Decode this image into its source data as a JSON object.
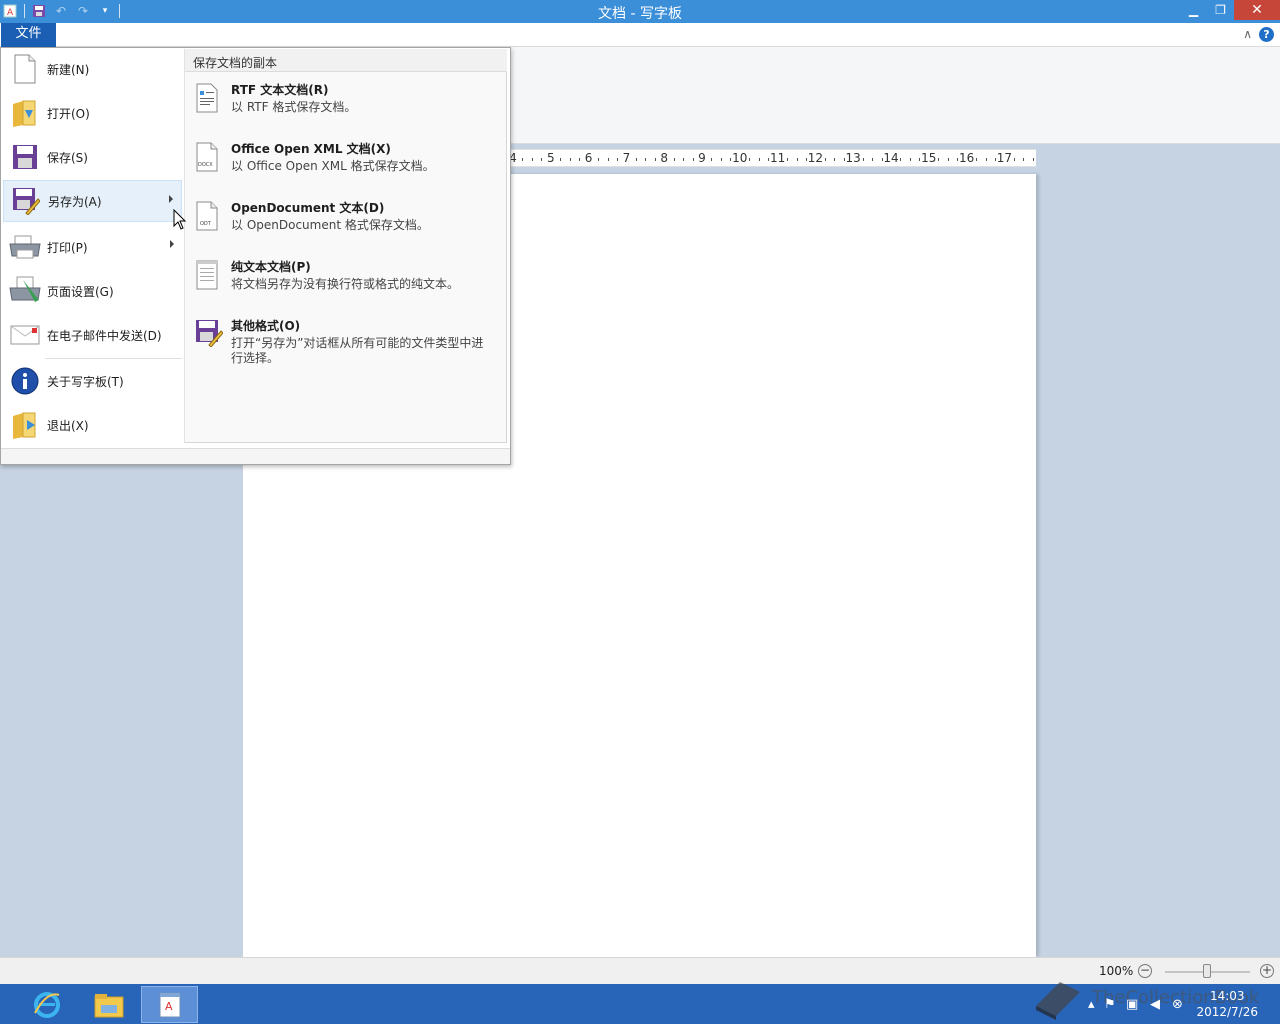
{
  "window": {
    "title": "文档 - 写字板"
  },
  "ribbon": {
    "file_tab": "文件",
    "help": "?",
    "collapse": "∧"
  },
  "ruler": {
    "labels": [
      "4",
      "5",
      "6",
      "7",
      "8",
      "9",
      "10",
      "11",
      "12",
      "13",
      "14",
      "15",
      "16",
      "17"
    ]
  },
  "file_menu": {
    "items": [
      {
        "label": "新建(N)",
        "icon": "new-document-icon"
      },
      {
        "label": "打开(O)",
        "icon": "open-folder-icon"
      },
      {
        "label": "保存(S)",
        "icon": "save-icon"
      },
      {
        "label": "另存为(A)",
        "icon": "save-as-icon",
        "selected": true,
        "has_submenu": true
      },
      {
        "label": "打印(P)",
        "icon": "print-icon",
        "has_submenu": true
      },
      {
        "label": "页面设置(G)",
        "icon": "page-setup-icon"
      },
      {
        "label": "在电子邮件中发送(D)",
        "icon": "email-icon"
      },
      {
        "label": "关于写字板(T)",
        "icon": "info-icon"
      },
      {
        "label": "退出(X)",
        "icon": "exit-icon"
      }
    ],
    "submenu": {
      "header": "保存文档的副本",
      "items": [
        {
          "title": "RTF 文本文档(R)",
          "desc": "以 RTF 格式保存文档。",
          "icon": "rtf-document-icon"
        },
        {
          "title": "Office Open XML 文档(X)",
          "desc": "以 Office Open XML 格式保存文档。",
          "icon": "docx-document-icon",
          "icon_text": "DOCX"
        },
        {
          "title": "OpenDocument  文本(D)",
          "desc": "以 OpenDocument 格式保存文档。",
          "icon": "odt-document-icon",
          "icon_text": "ODT"
        },
        {
          "title": "纯文本文档(P)",
          "desc": "将文档另存为没有换行符或格式的纯文本。",
          "icon": "plain-text-icon"
        },
        {
          "title": "其他格式(O)",
          "desc": "打开“另存为”对话框从所有可能的文件类型中进行选择。",
          "icon": "other-formats-icon"
        }
      ]
    }
  },
  "statusbar": {
    "zoom": "100%",
    "zoom_out": "−",
    "zoom_in": "+",
    "zoom_level": 1.0
  },
  "taskbar": {
    "clock_time": "14:03",
    "clock_date": "2012/7/26",
    "watermark": "TheCollectionBook"
  },
  "colors": {
    "titlebar": "#3b8ed8",
    "file_tab": "#1a5fb4",
    "taskbar": "#2864b7",
    "close_button": "#c7463a"
  }
}
